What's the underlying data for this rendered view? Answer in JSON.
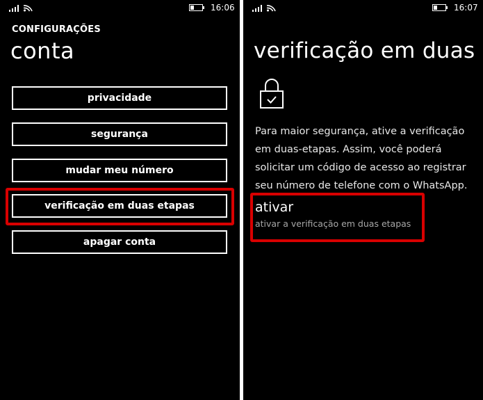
{
  "left_screen": {
    "status": {
      "time": "16:06"
    },
    "app_title": "CONFIGURAÇÕES",
    "page_title": "conta",
    "buttons": [
      {
        "label": "privacidade"
      },
      {
        "label": "segurança"
      },
      {
        "label": "mudar meu número"
      },
      {
        "label": "verificação em duas etapas"
      },
      {
        "label": "apagar conta"
      }
    ]
  },
  "right_screen": {
    "status": {
      "time": "16:07"
    },
    "page_title": "verificação em duas e",
    "icon": "lock-check-icon",
    "description": "Para maior segurança, ative a verificação em duas-etapas. Assim, você poderá solicitar um código de acesso ao registrar seu número de telefone com o WhatsApp.",
    "toggle": {
      "label": "ativar",
      "sublabel": "ativar a verificação em duas etapas"
    }
  },
  "colors": {
    "background": "#000000",
    "foreground": "#ffffff",
    "highlight": "#d80000",
    "secondary_text": "#a8a8a8"
  }
}
